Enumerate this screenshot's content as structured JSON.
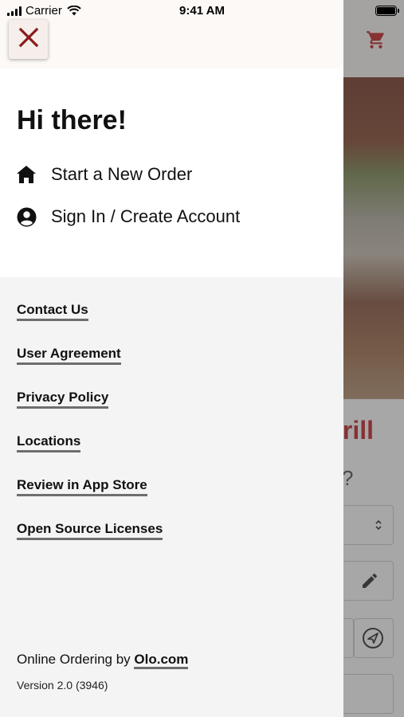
{
  "status_bar": {
    "carrier": "Carrier",
    "time": "9:41 AM"
  },
  "drawer": {
    "greeting": "Hi there!",
    "menu": [
      {
        "label": "Start a New Order",
        "icon": "home-icon"
      },
      {
        "label": "Sign In / Create Account",
        "icon": "user-circle-icon"
      }
    ],
    "links": [
      "Contact Us",
      "User Agreement",
      "Privacy Policy",
      "Locations",
      "Review in App Store",
      "Open Source Licenses"
    ],
    "footer": {
      "prefix": "Online Ordering by ",
      "link": "Olo.com",
      "version": "Version 2.0 (3946)"
    }
  },
  "background": {
    "restaurant_title_fragment": "rill",
    "question_fragment": "?"
  },
  "colors": {
    "accent_red": "#c5282d",
    "close_icon": "#8b1a1a",
    "drawer_bg": "#f4f4f4",
    "link_underline": "#6e6e6e"
  }
}
